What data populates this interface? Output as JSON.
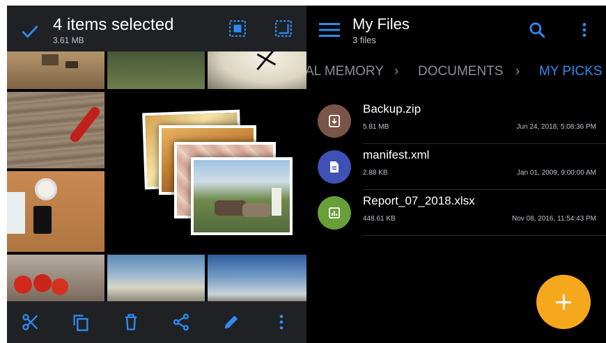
{
  "selection": {
    "title": "4 items selected",
    "size": "3.61 MB"
  },
  "gallery": {
    "photos": [
      "sand-beach",
      "field",
      "clock",
      "wood-chili",
      "coffee-phone",
      "tomatoes",
      "mountains",
      "sky"
    ],
    "stack": [
      "flowers",
      "street",
      "tiles",
      "cows"
    ]
  },
  "bottom_bar": {
    "actions": [
      "cut",
      "copy",
      "delete",
      "share",
      "edit",
      "more"
    ]
  },
  "files_app": {
    "title": "My Files",
    "subtitle": "3 files",
    "breadcrumb": [
      "AL MEMORY",
      "DOCUMENTS",
      "MY PICKS"
    ],
    "files": [
      {
        "name": "Backup.zip",
        "size": "5.81 MB",
        "date": "Jun 24, 2018, 5:08:36 PM",
        "icon": "archive-icon",
        "color": "#795548"
      },
      {
        "name": "manifest.xml",
        "size": "2.88 KB",
        "date": "Jan 01, 2009, 9:00:00 AM",
        "icon": "document-icon",
        "color": "#3f51b5"
      },
      {
        "name": "Report_07_2018.xlsx",
        "size": "448.61 KB",
        "date": "Nov 08, 2016, 11:54:43 PM",
        "icon": "spreadsheet-icon",
        "color": "#689f38"
      }
    ]
  },
  "colors": {
    "accent": "#2d8cf0",
    "fab": "#f6a81c",
    "bar": "#1f2125"
  }
}
